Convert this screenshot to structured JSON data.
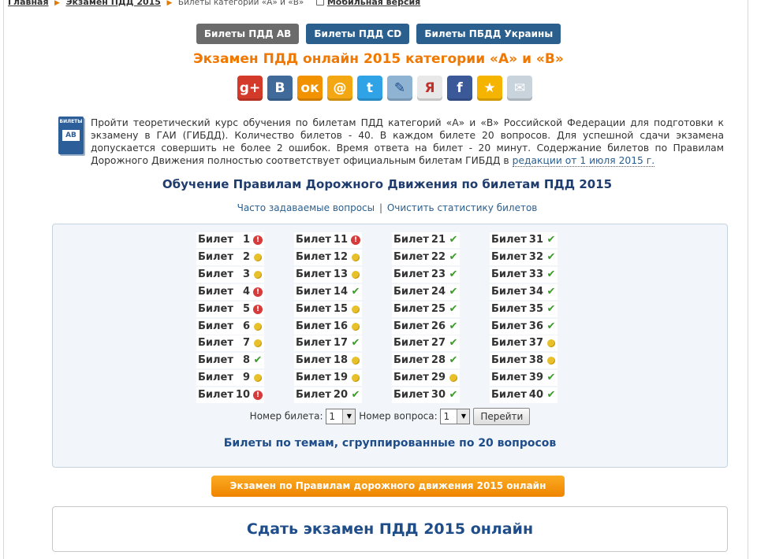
{
  "breadcrumb": {
    "home": "Главная",
    "exam": "Экзамен ПДД 2015",
    "current": "Билеты категории «А» и «В»",
    "mobile": "Мобильная версия"
  },
  "nav": {
    "tickets_ab": "Билеты ПДД AB",
    "tickets_cd": "Билеты ПДД CD",
    "tickets_ua": "Билеты ПБДД Украины"
  },
  "title": "Экзамен ПДД онлайн 2015 категории «А» и «В»",
  "social": [
    {
      "name": "googleplus-icon",
      "glyph": "g+",
      "color": "#d43a2a"
    },
    {
      "name": "vkontakte-icon",
      "glyph": "В",
      "color": "#3f6a9a"
    },
    {
      "name": "odnoklassniki-icon",
      "glyph": "ок",
      "color": "#f29200"
    },
    {
      "name": "mailru-icon",
      "glyph": "@",
      "color": "#f3a712"
    },
    {
      "name": "twitter-icon",
      "glyph": "t",
      "color": "#2fa3e6"
    },
    {
      "name": "livejournal-icon",
      "glyph": "✎",
      "color": "#8fb3d3"
    },
    {
      "name": "yandex-icon",
      "glyph": "Я",
      "color": "#e8e8e8"
    },
    {
      "name": "facebook-icon",
      "glyph": "f",
      "color": "#3b5998"
    },
    {
      "name": "favorites-icon",
      "glyph": "★",
      "color": "#f5b400"
    },
    {
      "name": "email-icon",
      "glyph": "✉",
      "color": "#c9d3dc"
    }
  ],
  "book_icon": {
    "top": "БИЛЕТЫ",
    "label": "AB"
  },
  "intro": {
    "text": "Пройти теоретический курс обучения по билетам ПДД категорий «А» и «В» Российской Федерации для подготовки к экзамену в ГАИ (ГИБДД). Количество билетов - 40. В каждом билете 20 вопросов. Для успешной сдачи экзамена допускается совершить не более 2 ошибок. Время ответа на билет - 20 минут. Содержание билетов по Правилам Дорожного Движения полностью соответствует официальным билетам ГИБДД в",
    "link": "редакции от 1 июля 2015 г."
  },
  "subheading": "Обучение Правилам Дорожного Движения по билетам ПДД 2015",
  "links": {
    "faq": "Часто задаваемые вопросы",
    "separator": "|",
    "clear": "Очистить статистику билетов"
  },
  "ticket_label": "Билет",
  "tickets": [
    {
      "num": 1,
      "status": "error"
    },
    {
      "num": 2,
      "status": "partial"
    },
    {
      "num": 3,
      "status": "partial"
    },
    {
      "num": 4,
      "status": "error"
    },
    {
      "num": 5,
      "status": "error"
    },
    {
      "num": 6,
      "status": "partial"
    },
    {
      "num": 7,
      "status": "partial"
    },
    {
      "num": 8,
      "status": "passed"
    },
    {
      "num": 9,
      "status": "partial"
    },
    {
      "num": 10,
      "status": "error"
    },
    {
      "num": 11,
      "status": "error"
    },
    {
      "num": 12,
      "status": "partial"
    },
    {
      "num": 13,
      "status": "partial"
    },
    {
      "num": 14,
      "status": "passed"
    },
    {
      "num": 15,
      "status": "partial"
    },
    {
      "num": 16,
      "status": "partial"
    },
    {
      "num": 17,
      "status": "passed"
    },
    {
      "num": 18,
      "status": "partial"
    },
    {
      "num": 19,
      "status": "partial"
    },
    {
      "num": 20,
      "status": "passed"
    },
    {
      "num": 21,
      "status": "passed"
    },
    {
      "num": 22,
      "status": "passed"
    },
    {
      "num": 23,
      "status": "passed"
    },
    {
      "num": 24,
      "status": "passed"
    },
    {
      "num": 25,
      "status": "passed"
    },
    {
      "num": 26,
      "status": "passed"
    },
    {
      "num": 27,
      "status": "passed"
    },
    {
      "num": 28,
      "status": "passed"
    },
    {
      "num": 29,
      "status": "partial"
    },
    {
      "num": 30,
      "status": "passed"
    },
    {
      "num": 31,
      "status": "passed"
    },
    {
      "num": 32,
      "status": "passed"
    },
    {
      "num": 33,
      "status": "passed"
    },
    {
      "num": 34,
      "status": "passed"
    },
    {
      "num": 35,
      "status": "passed"
    },
    {
      "num": 36,
      "status": "passed"
    },
    {
      "num": 37,
      "status": "partial"
    },
    {
      "num": 38,
      "status": "partial"
    },
    {
      "num": 39,
      "status": "passed"
    },
    {
      "num": 40,
      "status": "passed"
    }
  ],
  "controls": {
    "ticket_label": "Номер билета:",
    "ticket_value": "1",
    "question_label": "Номер вопроса:",
    "question_value": "1",
    "go": "Перейти"
  },
  "themes_link": "Билеты по темам, сгруппированные по 20 вопросов",
  "orange_button": "Экзамен по Правилам дорожного движения 2015 онлайн",
  "exam_box": "Сдать экзамен ПДД 2015 онлайн"
}
